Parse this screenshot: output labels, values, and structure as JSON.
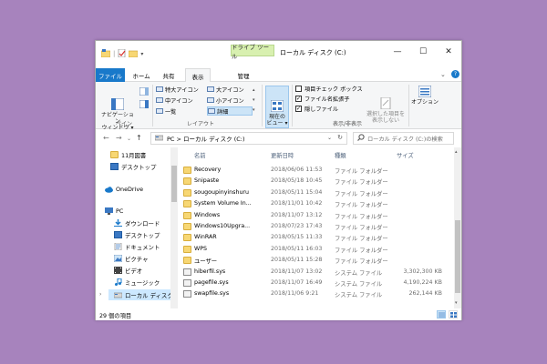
{
  "window": {
    "title": "ローカル ディスク (C:)",
    "context_tab": "ドライブ ツール",
    "minimize": "—",
    "maximize": "☐",
    "close": "✕"
  },
  "tabs": {
    "file": "ファイル",
    "home": "ホーム",
    "share": "共有",
    "view": "表示",
    "manage": "管理"
  },
  "ribbon": {
    "nav_pane": "ナビゲーション\nウィンドウ ▾",
    "pane_group": "ペイン",
    "layout_group": "レイアウト",
    "layouts": [
      "特大アイコン",
      "大アイコン",
      "中アイコン",
      "小アイコン",
      "一覧",
      "詳細"
    ],
    "current_view": "現在の\nビュー ▾",
    "checkboxes": [
      {
        "label": "項目チェック ボックス",
        "checked": false
      },
      {
        "label": "ファイル名拡張子",
        "checked": true
      },
      {
        "label": "隠しファイル",
        "checked": true
      }
    ],
    "hide_selected": "選択した項目を\n表示しない",
    "show_hide_group": "表示/非表示",
    "options": "オプション"
  },
  "address": {
    "path": "PC  >  ローカル ディスク (C:)",
    "search_placeholder": "ローカル ディスク (C:)の検索"
  },
  "navpane": {
    "items": [
      {
        "label": "11月図書",
        "icon": "folder-icon"
      },
      {
        "label": "デスクトップ",
        "icon": "desktop-folder-icon"
      },
      {
        "label": "OneDrive",
        "icon": "cloud-icon"
      },
      {
        "label": "PC",
        "icon": "pc-icon"
      },
      {
        "label": "ダウンロード",
        "icon": "download-icon"
      },
      {
        "label": "デスクトップ",
        "icon": "desktop-folder-icon"
      },
      {
        "label": "ドキュメント",
        "icon": "document-icon"
      },
      {
        "label": "ピクチャ",
        "icon": "picture-icon"
      },
      {
        "label": "ビデオ",
        "icon": "video-icon"
      },
      {
        "label": "ミュージック",
        "icon": "music-icon"
      },
      {
        "label": "ローカル ディスク (C",
        "icon": "drive-icon"
      }
    ]
  },
  "columns": {
    "name": "名前",
    "date": "更新日時",
    "type": "種類",
    "size": "サイズ"
  },
  "files": [
    {
      "name": "Recovery",
      "date": "2018/06/06 11:53",
      "type": "ファイル フォルダー",
      "size": "",
      "kind": "folder"
    },
    {
      "name": "Snipaste",
      "date": "2018/05/18 10:45",
      "type": "ファイル フォルダー",
      "size": "",
      "kind": "folder"
    },
    {
      "name": "sougoupinyinshuru",
      "date": "2018/05/11 15:04",
      "type": "ファイル フォルダー",
      "size": "",
      "kind": "folder"
    },
    {
      "name": "System Volume In...",
      "date": "2018/11/01 10:42",
      "type": "ファイル フォルダー",
      "size": "",
      "kind": "folder"
    },
    {
      "name": "Windows",
      "date": "2018/11/07 13:12",
      "type": "ファイル フォルダー",
      "size": "",
      "kind": "folder"
    },
    {
      "name": "Windows10Upgra...",
      "date": "2018/07/23 17:43",
      "type": "ファイル フォルダー",
      "size": "",
      "kind": "folder"
    },
    {
      "name": "WinRAR",
      "date": "2018/05/15 11:33",
      "type": "ファイル フォルダー",
      "size": "",
      "kind": "folder"
    },
    {
      "name": "WPS",
      "date": "2018/05/11 16:03",
      "type": "ファイル フォルダー",
      "size": "",
      "kind": "folder"
    },
    {
      "name": "ユーザー",
      "date": "2018/05/11 15:28",
      "type": "ファイル フォルダー",
      "size": "",
      "kind": "folder"
    },
    {
      "name": "hiberfil.sys",
      "date": "2018/11/07 13:02",
      "type": "システム ファイル",
      "size": "3,302,300 KB",
      "kind": "sys"
    },
    {
      "name": "pagefile.sys",
      "date": "2018/11/07 16:49",
      "type": "システム ファイル",
      "size": "4,190,224 KB",
      "kind": "sys"
    },
    {
      "name": "swapfile.sys",
      "date": "2018/11/06 9:21",
      "type": "システム ファイル",
      "size": "262,144 KB",
      "kind": "sys"
    }
  ],
  "status": {
    "count": "29 個の項目"
  }
}
